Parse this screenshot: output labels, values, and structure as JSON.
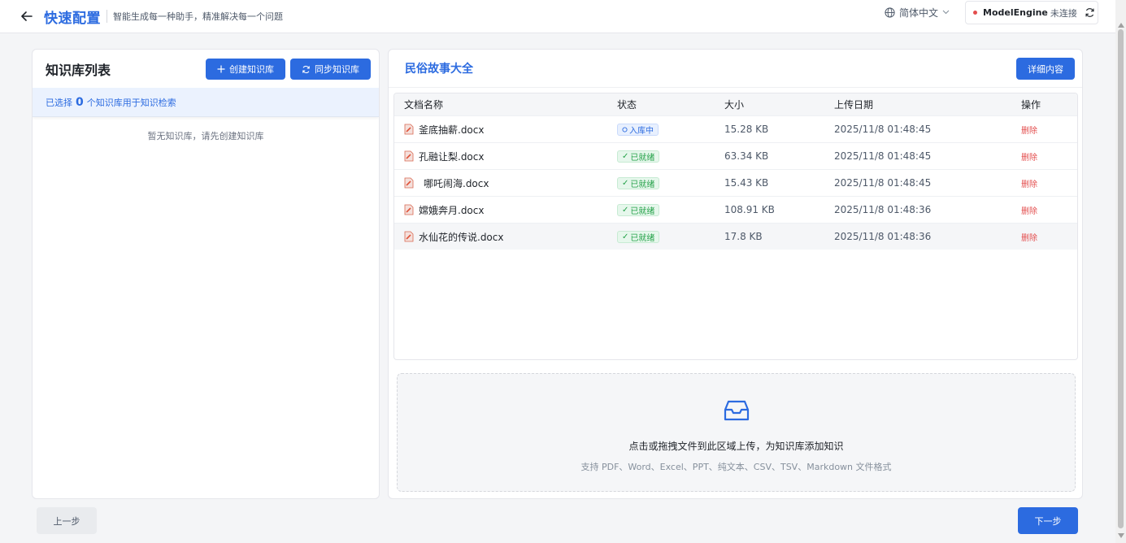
{
  "header": {
    "title": "快速配置",
    "subtitle": "智能生成每一种助手，精准解决每一个问题",
    "language": "简体中文",
    "connection": {
      "name": "ModelEngine",
      "status": "未连接"
    }
  },
  "left_panel": {
    "title": "知识库列表",
    "create_label": "创建知识库",
    "sync_label": "同步知识库",
    "selection": {
      "prefix": "已选择",
      "count": "0",
      "suffix": "个知识库用于知识检索"
    },
    "empty_text": "暂无知识库，请先创建知识库"
  },
  "right_panel": {
    "title": "民俗故事大全",
    "detail_label": "详细内容",
    "columns": [
      "文档名称",
      "状态",
      "大小",
      "上传日期",
      "操作"
    ],
    "rows": [
      {
        "name": "釜底抽薪.docx",
        "status": "入库中",
        "size": "15.28 KB",
        "date": "2025/11/8 01:48:45",
        "op": "删除"
      },
      {
        "name": "孔融让梨.docx",
        "status": "已就绪",
        "size": "63.34 KB",
        "date": "2025/11/8 01:48:45",
        "op": "删除"
      },
      {
        "name": "哪吒闹海.docx",
        "status": "已就绪",
        "size": "15.43 KB",
        "date": "2025/11/8 01:48:45",
        "op": "删除"
      },
      {
        "name": "嫦娥奔月.docx",
        "status": "已就绪",
        "size": "108.91 KB",
        "date": "2025/11/8 01:48:36",
        "op": "删除"
      },
      {
        "name": "水仙花的传说.docx",
        "status": "已就绪",
        "size": "17.8 KB",
        "date": "2025/11/8 01:48:36",
        "op": "删除"
      }
    ],
    "upload": {
      "main": "点击或拖拽文件到此区域上传，为知识库添加知识",
      "sub": "支持 PDF、Word、Excel、PPT、纯文本、CSV、TSV、Markdown 文件格式"
    }
  },
  "footer": {
    "prev_label": "上一步",
    "next_label": "下一步"
  },
  "colors": {
    "primary": "#2c6be0",
    "danger": "#e34d4d",
    "success": "#24a148"
  }
}
